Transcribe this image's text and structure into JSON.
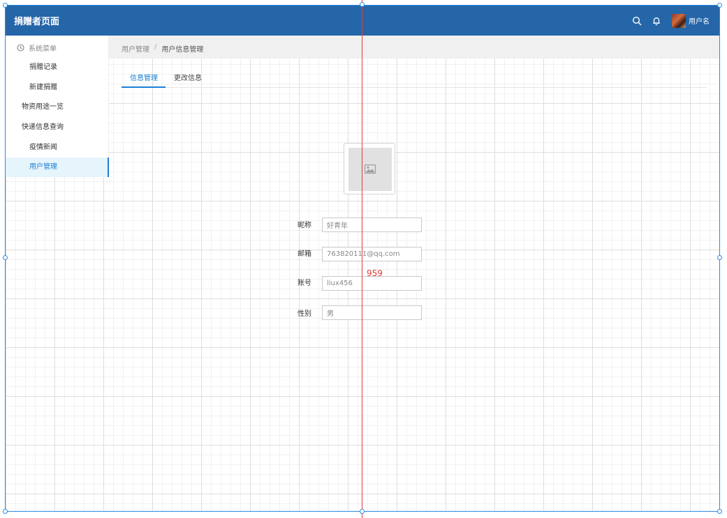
{
  "app": {
    "title": "捐赠者页面",
    "username": "用户名"
  },
  "header": {
    "icons": [
      "search-icon",
      "bell-icon",
      "avatar"
    ]
  },
  "sidebar": {
    "title": "系统菜单",
    "items": [
      {
        "label": "捐赠记录",
        "active": false
      },
      {
        "label": "新建捐赠",
        "active": false
      },
      {
        "label": "物资用途一览",
        "active": false
      },
      {
        "label": "快递信息查询",
        "active": false
      },
      {
        "label": "疫情新闻",
        "active": false
      },
      {
        "label": "用户管理",
        "active": true
      }
    ]
  },
  "breadcrumb": {
    "parent": "用户管理",
    "separator": "/",
    "current": "用户信息管理"
  },
  "tabs": [
    {
      "label": "信息管理",
      "active": true
    },
    {
      "label": "更改信息",
      "active": false
    }
  ],
  "form": {
    "nickname": {
      "label": "昵称",
      "value": "好青年"
    },
    "email": {
      "label": "邮箱",
      "value": "763820111@qq.com"
    },
    "account": {
      "label": "账号",
      "value": "liux456"
    },
    "gender": {
      "label": "性别",
      "value": "男"
    }
  },
  "overlay": {
    "measure_label": "959"
  },
  "colors": {
    "header": "#2466a8",
    "accent": "#1a7fd6",
    "guide": "#e53935"
  }
}
